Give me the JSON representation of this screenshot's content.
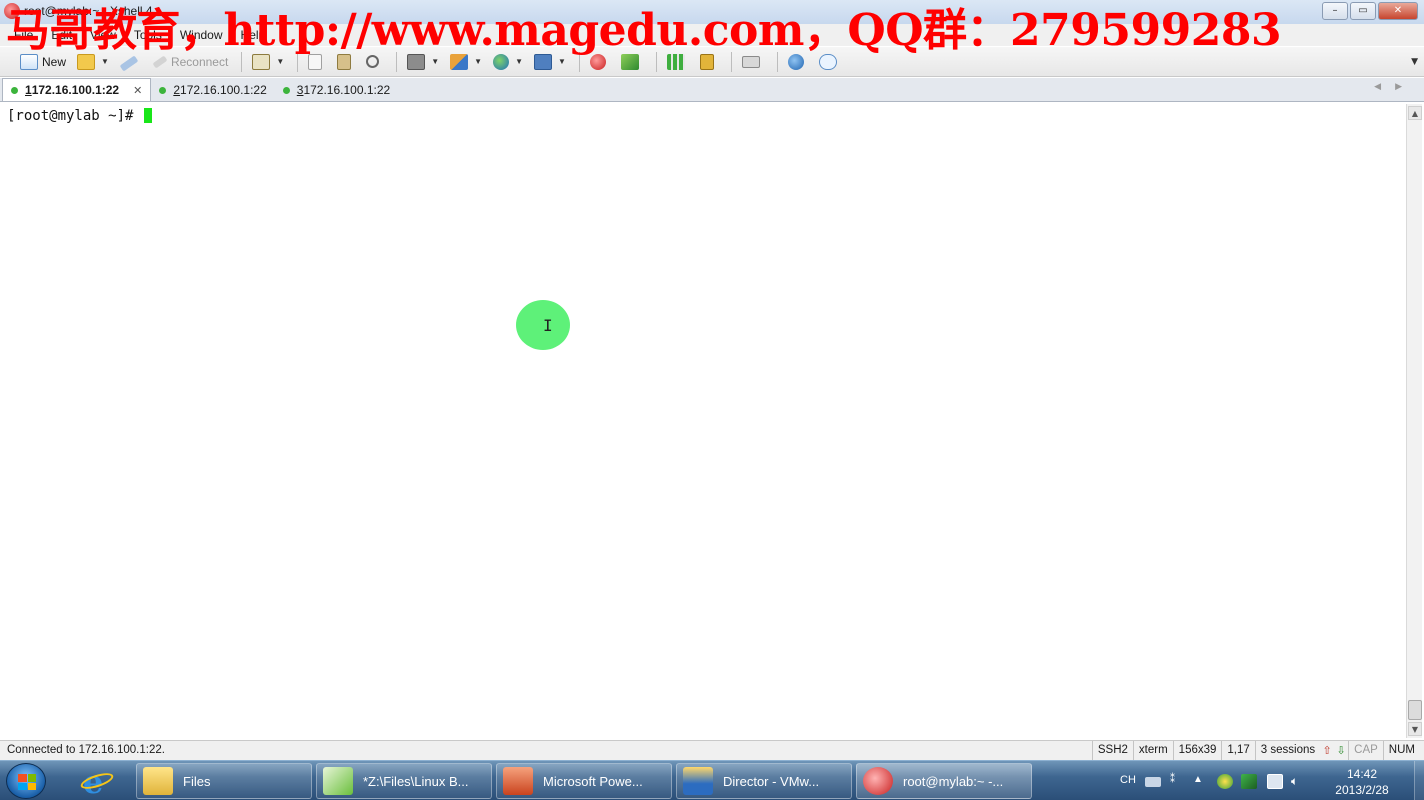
{
  "window": {
    "title": "root@mylab:~ - Xshell 4",
    "controls": {
      "minimize": "–",
      "restore": "▭",
      "close": "✕"
    }
  },
  "watermark": "马哥教育，http://www.magedu.com，QQ群：279599283",
  "menu": [
    "File",
    "Edit",
    "View",
    "Tools",
    "Window",
    "Help"
  ],
  "toolbar": {
    "new_label": "New",
    "reconnect_label": "Reconnect",
    "icons": {
      "new": "new-session-icon",
      "open": "folder-open-icon",
      "connect": "connect-icon",
      "reconnect": "reconnect-icon",
      "properties": "properties-icon",
      "copy": "copy-icon",
      "paste": "paste-icon",
      "find": "find-icon",
      "print": "print-icon",
      "transfer": "transfer-icon",
      "globe": "globe-icon",
      "font": "font-icon",
      "xshell": "xshell-icon",
      "xftp": "xftp-icon",
      "layout": "layout-icon",
      "lock": "lock-icon",
      "keyboard": "keyboard-icon",
      "help": "help-icon",
      "chat": "chat-icon"
    }
  },
  "tabs": [
    {
      "number": "1",
      "label": " 172.16.100.1:22",
      "active": true
    },
    {
      "number": "2",
      "label": " 172.16.100.1:22",
      "active": false
    },
    {
      "number": "3",
      "label": " 172.16.100.1:22",
      "active": false
    }
  ],
  "terminal": {
    "prompt": "[root@mylab ~]# ",
    "cursor_color": "#19e619"
  },
  "status": {
    "message": "Connected to 172.16.100.1:22.",
    "protocol": "SSH2",
    "term": "xterm",
    "size": "156x39",
    "position": "1,17",
    "sessions": "3 sessions",
    "cap": "CAP",
    "num": "NUM"
  },
  "taskbar": {
    "items": [
      {
        "label": "Files",
        "icon": "folder-icon"
      },
      {
        "label": "*Z:\\Files\\Linux B...",
        "icon": "notepad-icon"
      },
      {
        "label": "Microsoft Powe...",
        "icon": "powerpoint-icon"
      },
      {
        "label": "Director - VMw...",
        "icon": "vmware-icon"
      },
      {
        "label": "root@mylab:~ -...",
        "icon": "xshell-icon"
      }
    ],
    "lang": "CH",
    "time": "14:42",
    "date": "2013/2/28"
  },
  "colors": {
    "watermark": "#ff0000",
    "tab_dot": "#3cb43c",
    "pointer_highlight": "#4cf06a"
  }
}
